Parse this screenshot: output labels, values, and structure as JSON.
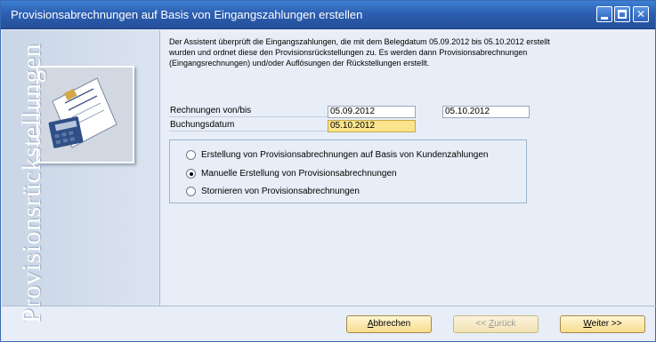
{
  "window": {
    "title": "Provisionsabrechnungen auf Basis von Eingangszahlungen erstellen",
    "controls": {
      "minimize": "minimize-icon",
      "maximize": "maximize-icon",
      "close": "close-icon"
    }
  },
  "sidebar": {
    "text": "Provisionsrückstellungen",
    "logo_icon": "document-calculator-icon"
  },
  "intro": {
    "line1": "Der Assistent überprüft die Eingangszahlungen, die mit dem Belegdatum 05.09.2012 bis 05.10.2012 erstellt",
    "line2": "wurden und ordnet diese den Provisionsrückstellungen zu. Es werden dann Provisionsabrechnungen",
    "line3": "(Eingangsrechnungen) und/oder Auflösungen der Rückstellungen erstellt."
  },
  "fields": {
    "invoices_label": "Rechnungen von/bis",
    "invoices_from": "05.09.2012",
    "invoices_to": "05.10.2012",
    "posting_date_label": "Buchungsdatum",
    "posting_date": "05.10.2012"
  },
  "options": {
    "selected": 1,
    "items": [
      {
        "label": "Erstellung von Provisionsabrechnungen auf Basis von Kundenzahlungen"
      },
      {
        "label": "Manuelle Erstellung von Provisionsabrechnungen"
      },
      {
        "label": "Stornieren von Provisionsabrechnungen"
      }
    ]
  },
  "buttons": {
    "cancel_accel": "A",
    "cancel_rest": "bbrechen",
    "back_prefix": "<< ",
    "back_accel": "Z",
    "back_rest": "urück",
    "next_accel": "W",
    "next_rest": "eiter >>"
  },
  "colors": {
    "titlebar": "#2c5fb1",
    "active_field": "#fbe48e",
    "button": "#f6dc8e"
  }
}
